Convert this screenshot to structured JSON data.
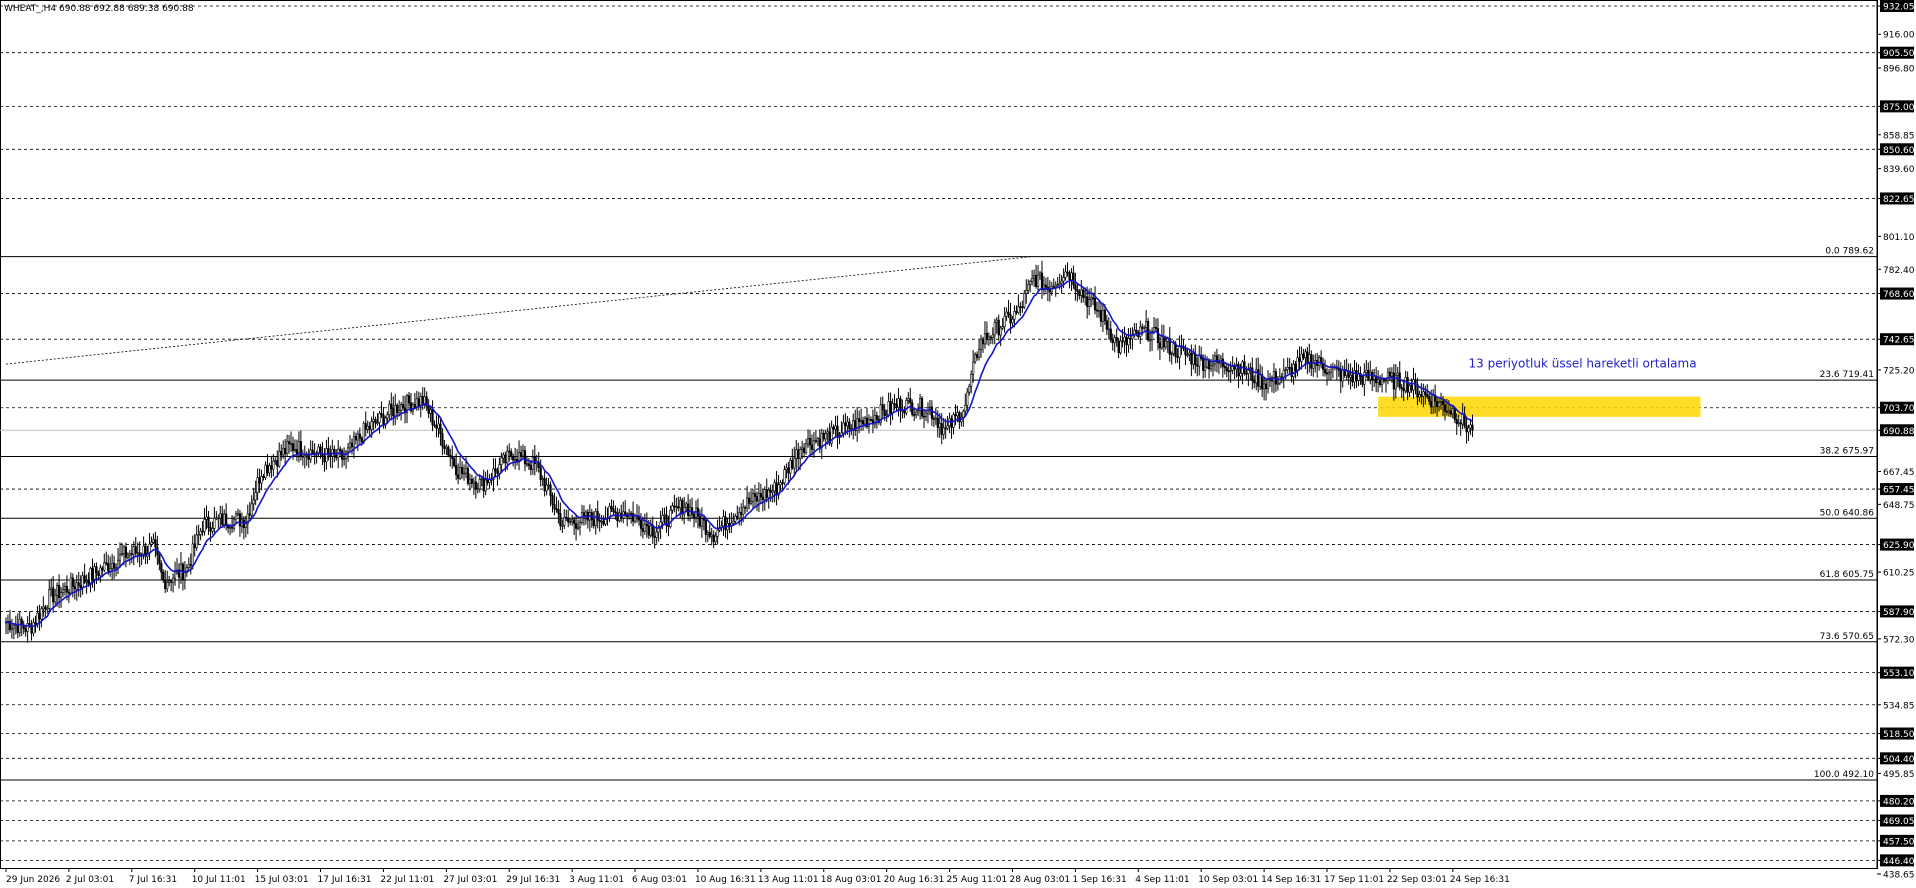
{
  "header": {
    "text": "WHEAT_,H4 690.88 692.88 689.38 690.88"
  },
  "chart_data": {
    "type": "candlestick",
    "symbol": "WHEAT_",
    "timeframe": "H4",
    "ohlc_header": [
      690.88,
      692.88,
      689.38,
      690.88
    ],
    "ylim": [
      438.65,
      932.05
    ],
    "current_price": 690.88,
    "y_ticks": [
      {
        "value": 932.05,
        "label": "932.05",
        "boxed": true
      },
      {
        "value": 916.0,
        "label": "916.00",
        "boxed": false
      },
      {
        "value": 905.5,
        "label": "905.50",
        "boxed": true
      },
      {
        "value": 896.8,
        "label": "896.80",
        "boxed": false
      },
      {
        "value": 875.0,
        "label": "875.00",
        "boxed": true
      },
      {
        "value": 858.85,
        "label": "858.85",
        "boxed": false
      },
      {
        "value": 850.6,
        "label": "850.60",
        "boxed": true
      },
      {
        "value": 839.6,
        "label": "839.60",
        "boxed": false
      },
      {
        "value": 822.65,
        "label": "822.65",
        "boxed": true
      },
      {
        "value": 801.1,
        "label": "801.10",
        "boxed": false
      },
      {
        "value": 782.4,
        "label": "782.40",
        "boxed": false
      },
      {
        "value": 768.6,
        "label": "768.60",
        "boxed": true
      },
      {
        "value": 742.65,
        "label": "742.65",
        "boxed": true
      },
      {
        "value": 725.2,
        "label": "725.20",
        "boxed": false
      },
      {
        "value": 703.7,
        "label": "703.70",
        "boxed": true
      },
      {
        "value": 690.88,
        "label": "690.88",
        "boxed": true
      },
      {
        "value": 667.45,
        "label": "667.45",
        "boxed": false
      },
      {
        "value": 657.45,
        "label": "657.45",
        "boxed": true
      },
      {
        "value": 648.75,
        "label": "648.75",
        "boxed": false
      },
      {
        "value": 625.9,
        "label": "625.90",
        "boxed": true
      },
      {
        "value": 610.25,
        "label": "610.25",
        "boxed": false
      },
      {
        "value": 587.9,
        "label": "587.90",
        "boxed": true
      },
      {
        "value": 572.3,
        "label": "572.30",
        "boxed": false
      },
      {
        "value": 553.1,
        "label": "553.10",
        "boxed": true
      },
      {
        "value": 534.85,
        "label": "534.85",
        "boxed": false
      },
      {
        "value": 518.5,
        "label": "518.50",
        "boxed": true
      },
      {
        "value": 504.4,
        "label": "504.40",
        "boxed": true
      },
      {
        "value": 495.85,
        "label": "495.85",
        "boxed": false
      },
      {
        "value": 480.2,
        "label": "480.20",
        "boxed": true
      },
      {
        "value": 469.05,
        "label": "469.05",
        "boxed": true
      },
      {
        "value": 457.5,
        "label": "457.50",
        "boxed": true
      },
      {
        "value": 446.4,
        "label": "446.40",
        "boxed": true
      },
      {
        "value": 438.65,
        "label": "438.65",
        "boxed": false
      }
    ],
    "x_labels": [
      {
        "bar": 0,
        "label": "29 Jun 2026"
      },
      {
        "bar": 32,
        "label": "2 Jul 03:01"
      },
      {
        "bar": 64,
        "label": "7 Jul 16:31"
      },
      {
        "bar": 96,
        "label": "10 Jul 11:01"
      },
      {
        "bar": 128,
        "label": "15 Jul 03:01"
      },
      {
        "bar": 160,
        "label": "17 Jul 16:31"
      },
      {
        "bar": 192,
        "label": "22 Jul 11:01"
      },
      {
        "bar": 224,
        "label": "27 Jul 03:01"
      },
      {
        "bar": 256,
        "label": "29 Jul 16:31"
      },
      {
        "bar": 288,
        "label": "3 Aug 11:01"
      },
      {
        "bar": 320,
        "label": "6 Aug 03:01"
      },
      {
        "bar": 352,
        "label": "10 Aug 16:31"
      },
      {
        "bar": 384,
        "label": "13 Aug 11:01"
      },
      {
        "bar": 416,
        "label": "18 Aug 03:01"
      },
      {
        "bar": 448,
        "label": "20 Aug 16:31"
      },
      {
        "bar": 480,
        "label": "25 Aug 11:01"
      },
      {
        "bar": 512,
        "label": "28 Aug 03:01"
      },
      {
        "bar": 544,
        "label": "1 Sep 16:31"
      },
      {
        "bar": 576,
        "label": "4 Sep 11:01"
      },
      {
        "bar": 608,
        "label": "10 Sep 03:01"
      },
      {
        "bar": 640,
        "label": "14 Sep 16:31"
      },
      {
        "bar": 672,
        "label": "17 Sep 11:01"
      },
      {
        "bar": 704,
        "label": "22 Sep 03:01"
      },
      {
        "bar": 736,
        "label": "24 Sep 16:31"
      }
    ],
    "x_bar_range": [
      0,
      760
    ],
    "dashed_levels": [
      905.5,
      875.0,
      850.6,
      822.65,
      768.6,
      742.65,
      703.7,
      657.45,
      625.9,
      587.9,
      553.1,
      534.85,
      518.5,
      504.4,
      480.2,
      469.05,
      457.5,
      446.4,
      932.05
    ],
    "fibonacci": {
      "high": 789.62,
      "low": 492.1,
      "levels": [
        {
          "ratio": "0.0",
          "value": 789.62
        },
        {
          "ratio": "23.6",
          "value": 719.41
        },
        {
          "ratio": "38.2",
          "value": 675.97
        },
        {
          "ratio": "50.0",
          "value": 640.86
        },
        {
          "ratio": "61.8",
          "value": 605.75
        },
        {
          "ratio": "73.6",
          "value": 570.65
        },
        {
          "ratio": "100.0",
          "value": 492.1
        }
      ]
    },
    "trend_line": {
      "from": {
        "bar": 0,
        "value": 728.5
      },
      "to": {
        "bar": 522,
        "value": 789.62
      }
    },
    "highlight_zone": {
      "bar_from": 698,
      "bar_to": 862,
      "high": 710.0,
      "low": 698.5,
      "color": "#FFD700"
    },
    "annotation": {
      "text": "13 periyotluk üssel hareketli ortalama",
      "bar": 744,
      "value": 726.5,
      "color": "#2222CC"
    },
    "ma_period": 13,
    "ma_color": "#1414C8",
    "anchors": [
      [
        0,
        582
      ],
      [
        12,
        578
      ],
      [
        22,
        596
      ],
      [
        40,
        606
      ],
      [
        60,
        620
      ],
      [
        75,
        624
      ],
      [
        80,
        605
      ],
      [
        92,
        612
      ],
      [
        100,
        637
      ],
      [
        110,
        640
      ],
      [
        122,
        640
      ],
      [
        130,
        668
      ],
      [
        145,
        682
      ],
      [
        160,
        677
      ],
      [
        172,
        675
      ],
      [
        182,
        690
      ],
      [
        200,
        705
      ],
      [
        212,
        708
      ],
      [
        218,
        695
      ],
      [
        230,
        668
      ],
      [
        242,
        660
      ],
      [
        258,
        678
      ],
      [
        270,
        670
      ],
      [
        283,
        638
      ],
      [
        300,
        641
      ],
      [
        315,
        645
      ],
      [
        330,
        634
      ],
      [
        345,
        649
      ],
      [
        360,
        632
      ],
      [
        375,
        648
      ],
      [
        392,
        658
      ],
      [
        405,
        683
      ],
      [
        420,
        688
      ],
      [
        440,
        698
      ],
      [
        455,
        706
      ],
      [
        470,
        703
      ],
      [
        478,
        690
      ],
      [
        488,
        705
      ],
      [
        495,
        740
      ],
      [
        505,
        750
      ],
      [
        515,
        758
      ],
      [
        523,
        778
      ],
      [
        530,
        772
      ],
      [
        540,
        782
      ],
      [
        548,
        768
      ],
      [
        558,
        755
      ],
      [
        566,
        738
      ],
      [
        580,
        748
      ],
      [
        592,
        738
      ],
      [
        608,
        730
      ],
      [
        625,
        728
      ],
      [
        640,
        718
      ],
      [
        650,
        722
      ],
      [
        662,
        732
      ],
      [
        680,
        722
      ],
      [
        700,
        720
      ],
      [
        712,
        718
      ],
      [
        726,
        708
      ],
      [
        736,
        702
      ],
      [
        742,
        694
      ],
      [
        746,
        690.88
      ]
    ],
    "series": [
      {
        "name": "13 periyotluk üssel hareketli ortalama",
        "kind": "ema"
      }
    ]
  }
}
